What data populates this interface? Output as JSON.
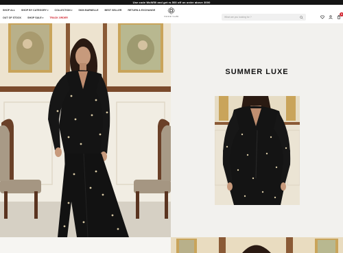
{
  "promo": {
    "text": "Use code WoW50 and get rs 500 off on order above 3000"
  },
  "nav": {
    "row1": [
      {
        "label": "SHOP ALL",
        "chevron": false
      },
      {
        "label": "SHOP BY CATEGORY",
        "chevron": true
      },
      {
        "label": "COLLECTION",
        "chevron": true
      },
      {
        "label": "SKIN BARNELLE",
        "chevron": false
      },
      {
        "label": "BEST SELLER",
        "chevron": false
      },
      {
        "label": "RETURN & EXCHANGE",
        "chevron": false
      }
    ],
    "row2": [
      {
        "label": "OUT OF STOCK"
      },
      {
        "label": "SHOP SALE",
        "chevron": true
      },
      {
        "label": "TRACK ORDER",
        "sale": true
      }
    ]
  },
  "logo": {
    "text": "NOOR SABI"
  },
  "search": {
    "placeholder": "What are you looking for ?"
  },
  "cart": {
    "count": "0"
  },
  "hero": {
    "title": "SUMMER LUXE"
  },
  "icons": [
    "search-icon",
    "heart-icon",
    "user-icon",
    "cart-icon"
  ],
  "colors": {
    "promo_bg": "#151515",
    "sale": "#d0202c",
    "panel_bg": "#f2f1ee"
  }
}
